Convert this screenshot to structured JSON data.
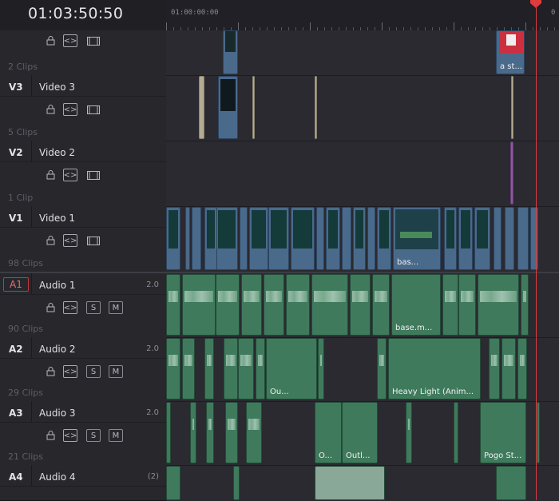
{
  "timecode": "01:03:50:50",
  "ruler": {
    "start": "01:00:00:00",
    "end_partial": "0"
  },
  "tracks": [
    {
      "id": "",
      "name": "",
      "clips": "2 Clips",
      "type": "video"
    },
    {
      "id": "V3",
      "name": "Video 3",
      "clips": "5 Clips",
      "type": "video"
    },
    {
      "id": "V2",
      "name": "Video 2",
      "clips": "1 Clip",
      "type": "video"
    },
    {
      "id": "V1",
      "name": "Video 1",
      "clips": "98 Clips",
      "type": "video"
    },
    {
      "id": "A1",
      "name": "Audio 1",
      "vol": "2.0",
      "clips": "90 Clips",
      "type": "audio"
    },
    {
      "id": "A2",
      "name": "Audio 2",
      "vol": "2.0",
      "clips": "29 Clips",
      "type": "audio"
    },
    {
      "id": "A3",
      "name": "Audio 3",
      "vol": "2.0",
      "clips": "21 Clips",
      "type": "audio"
    },
    {
      "id": "A4",
      "name": "Audio 4",
      "vol": "(2)",
      "clips": "",
      "type": "audio"
    }
  ],
  "buttons": {
    "solo": "S",
    "mute": "M"
  },
  "clip_labels": {
    "v4_clip": "a st...",
    "v1_clip": "bas...",
    "a1_clip": "base.m...",
    "a2_clip_ou": "Ou...",
    "a2_clip_heavy": "Heavy Light (Anim...",
    "a3_clip_o": "O...",
    "a3_clip_outl": "Outl...",
    "a3_clip_pogo": "Pogo St..."
  },
  "colors": {
    "playhead": "#e03c3c",
    "video_clip": "#4a6a8c",
    "audio_clip": "#3f7a5c"
  }
}
